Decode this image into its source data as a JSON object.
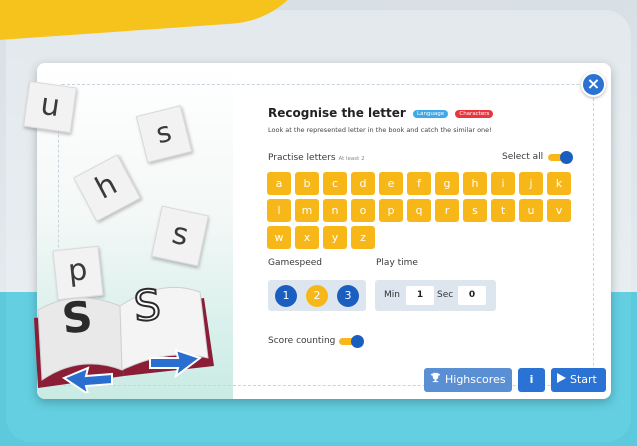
{
  "game": {
    "title": "Recognise the letter",
    "badges": [
      "Language",
      "Characters"
    ],
    "subtitle": "Look at the represented letter in the book and catch the similar one!",
    "practise_label": "Practise letters",
    "practise_hint": "At least 2",
    "select_all_label": "Select all",
    "select_all_on": true,
    "letters": [
      "a",
      "b",
      "c",
      "d",
      "e",
      "f",
      "g",
      "h",
      "i",
      "j",
      "k",
      "l",
      "m",
      "n",
      "o",
      "p",
      "q",
      "r",
      "s",
      "t",
      "u",
      "v",
      "w",
      "x",
      "y",
      "z"
    ],
    "gamespeed_label": "Gamespeed",
    "gamespeed_options": [
      "1",
      "2",
      "3"
    ],
    "gamespeed_selected": "2",
    "playtime_label": "Play time",
    "min_label": "Min",
    "min_value": "1",
    "sec_label": "Sec",
    "sec_value": "0",
    "score_counting_label": "Score counting",
    "score_counting_on": true,
    "highscores_label": "Highscores",
    "info_label": "i",
    "start_label": "Start",
    "close_label": "×"
  },
  "illustration": {
    "floating_letters": [
      "u",
      "s",
      "h",
      "s",
      "p"
    ],
    "book_letters": [
      "S",
      "S"
    ]
  },
  "colors": {
    "accent_yellow": "#f7b719",
    "accent_blue": "#2a73d4",
    "badge_blue": "#3fa9e8",
    "badge_red": "#e8363f"
  }
}
